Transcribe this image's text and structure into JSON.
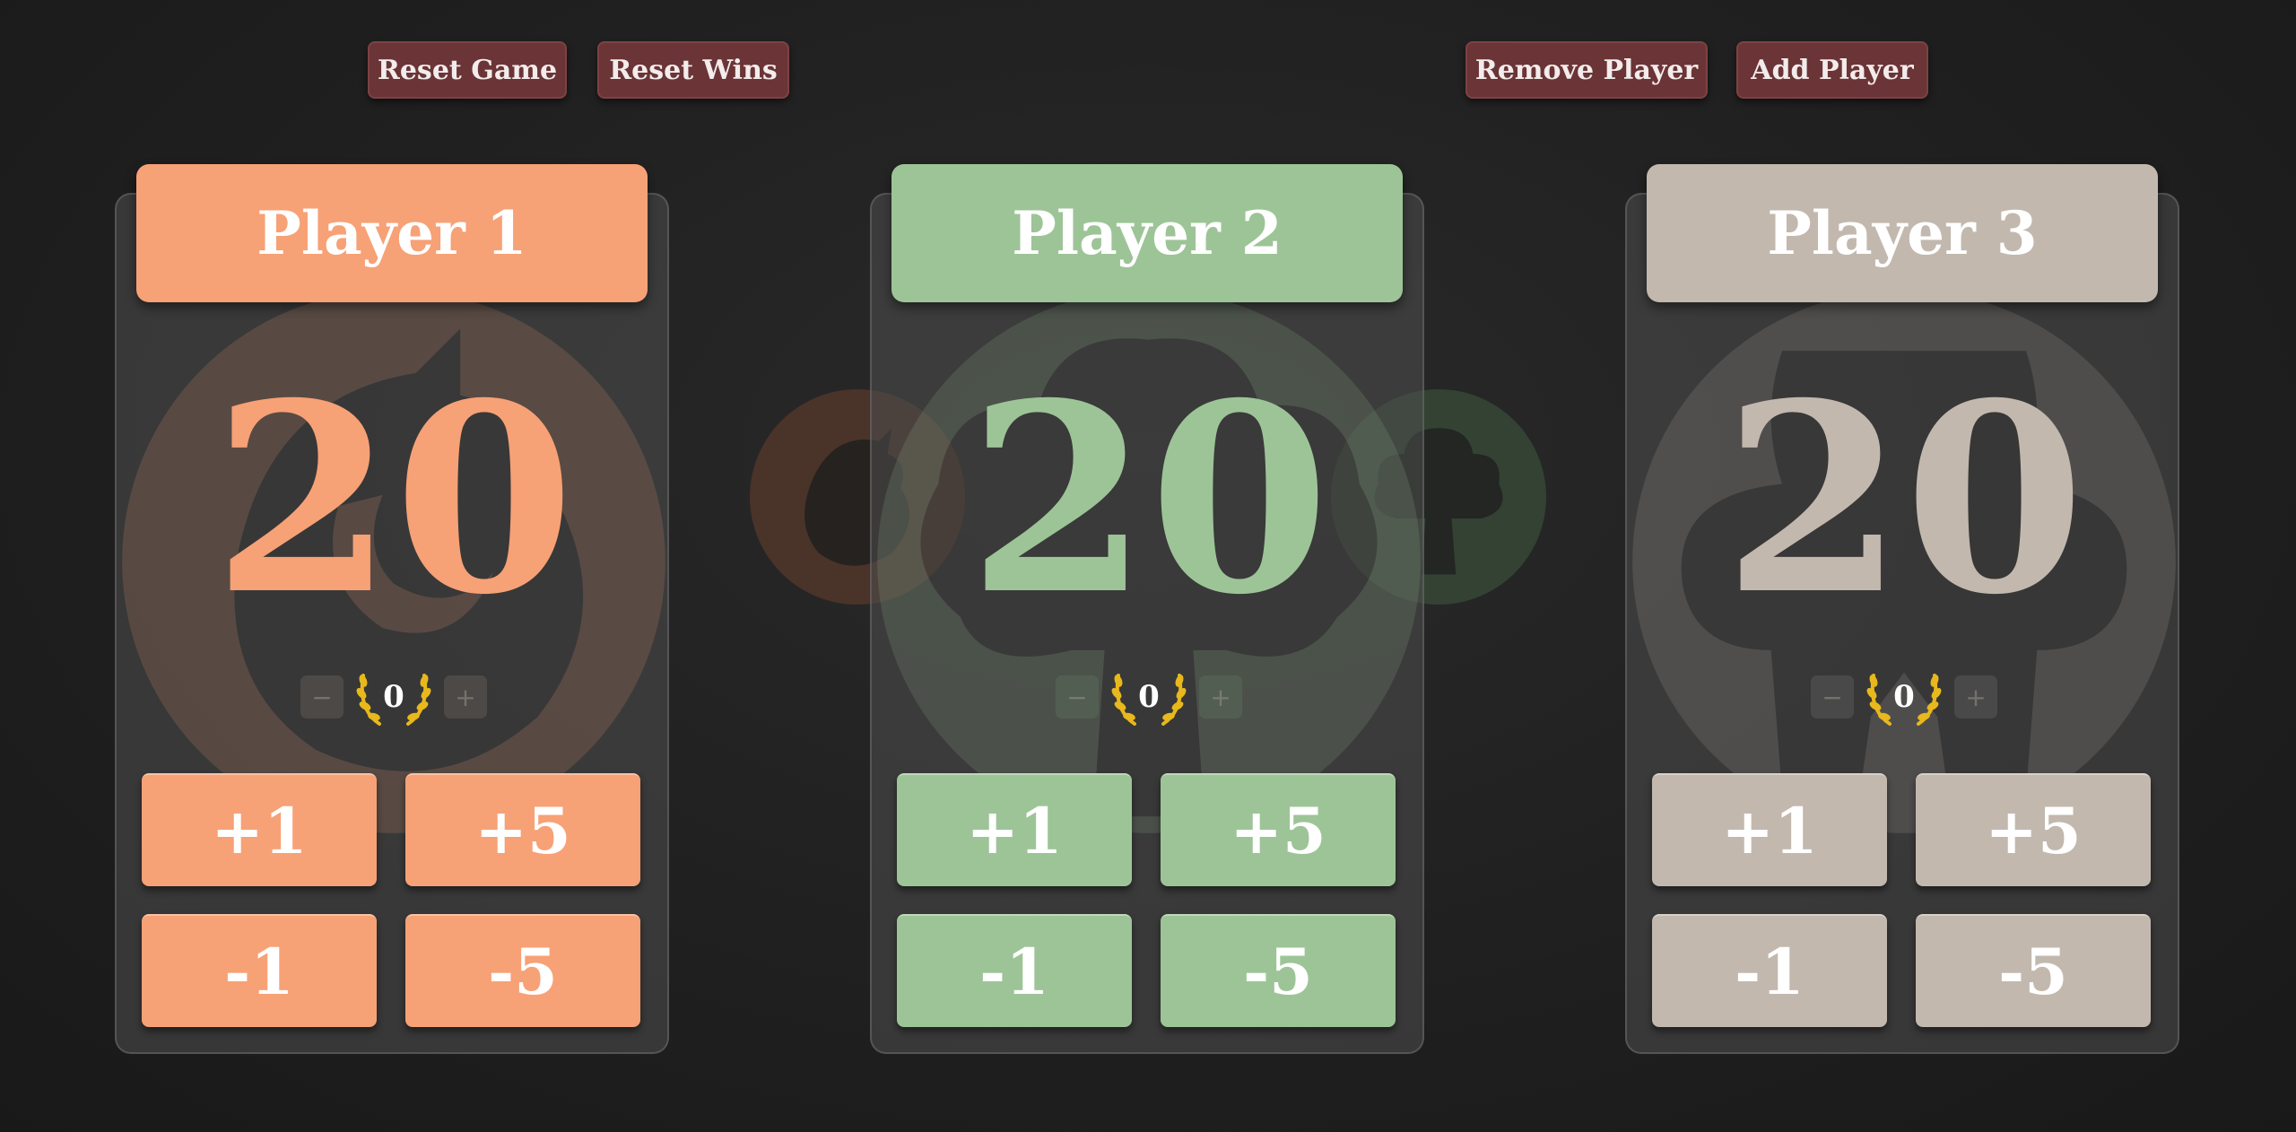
{
  "toolbar": {
    "reset_game": "Reset Game",
    "reset_wins": "Reset Wins",
    "remove_player": "Remove Player",
    "add_player": "Add Player"
  },
  "players": [
    {
      "name": "Player 1",
      "life": "20",
      "wins": "0",
      "color": "#f7a176",
      "emblem": "dragon-icon",
      "buttons": {
        "plus1": "+1",
        "plus5": "+5",
        "minus1": "-1",
        "minus5": "-5"
      },
      "wins_minus": "−",
      "wins_plus": "+"
    },
    {
      "name": "Player 2",
      "life": "20",
      "wins": "0",
      "color": "#9dc497",
      "emblem": "tree-icon",
      "buttons": {
        "plus1": "+1",
        "plus5": "+5",
        "minus1": "-1",
        "minus5": "-5"
      },
      "wins_minus": "−",
      "wins_plus": "+"
    },
    {
      "name": "Player 3",
      "life": "20",
      "wins": "0",
      "color": "#c2b8ae",
      "emblem": "skull-icon",
      "buttons": {
        "plus1": "+1",
        "plus5": "+5",
        "minus1": "-1",
        "minus5": "-5"
      },
      "wins_minus": "−",
      "wins_plus": "+"
    }
  ],
  "colors": {
    "top_button": "#6b3436",
    "laurel": "#e8b81c",
    "background": "#1f1f1f"
  }
}
